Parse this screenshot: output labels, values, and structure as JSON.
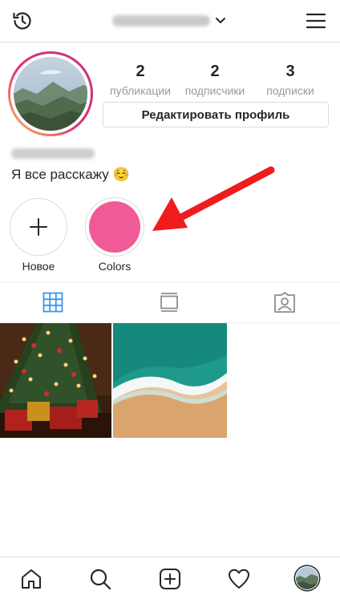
{
  "header": {
    "username": "",
    "history_icon": "history-icon",
    "menu_icon": "hamburger-menu-icon"
  },
  "profile": {
    "stats": [
      {
        "value": "2",
        "label": "публикации"
      },
      {
        "value": "2",
        "label": "подписчики"
      },
      {
        "value": "3",
        "label": "подписки"
      }
    ],
    "edit_label": "Редактировать профиль",
    "bio": "Я все расскажу ☺️"
  },
  "highlights": [
    {
      "label": "Новое"
    },
    {
      "label": "Colors",
      "color": "#f05a96"
    }
  ],
  "tabs": [
    "grid-icon",
    "feed-icon",
    "tagged-icon"
  ],
  "colors": {
    "accent": "#3897f0",
    "arrow": "#ee1c1c",
    "border": "#dbdbdb"
  },
  "bottom_nav": [
    "home-icon",
    "search-icon",
    "add-post-icon",
    "heart-icon",
    "profile-avatar"
  ]
}
